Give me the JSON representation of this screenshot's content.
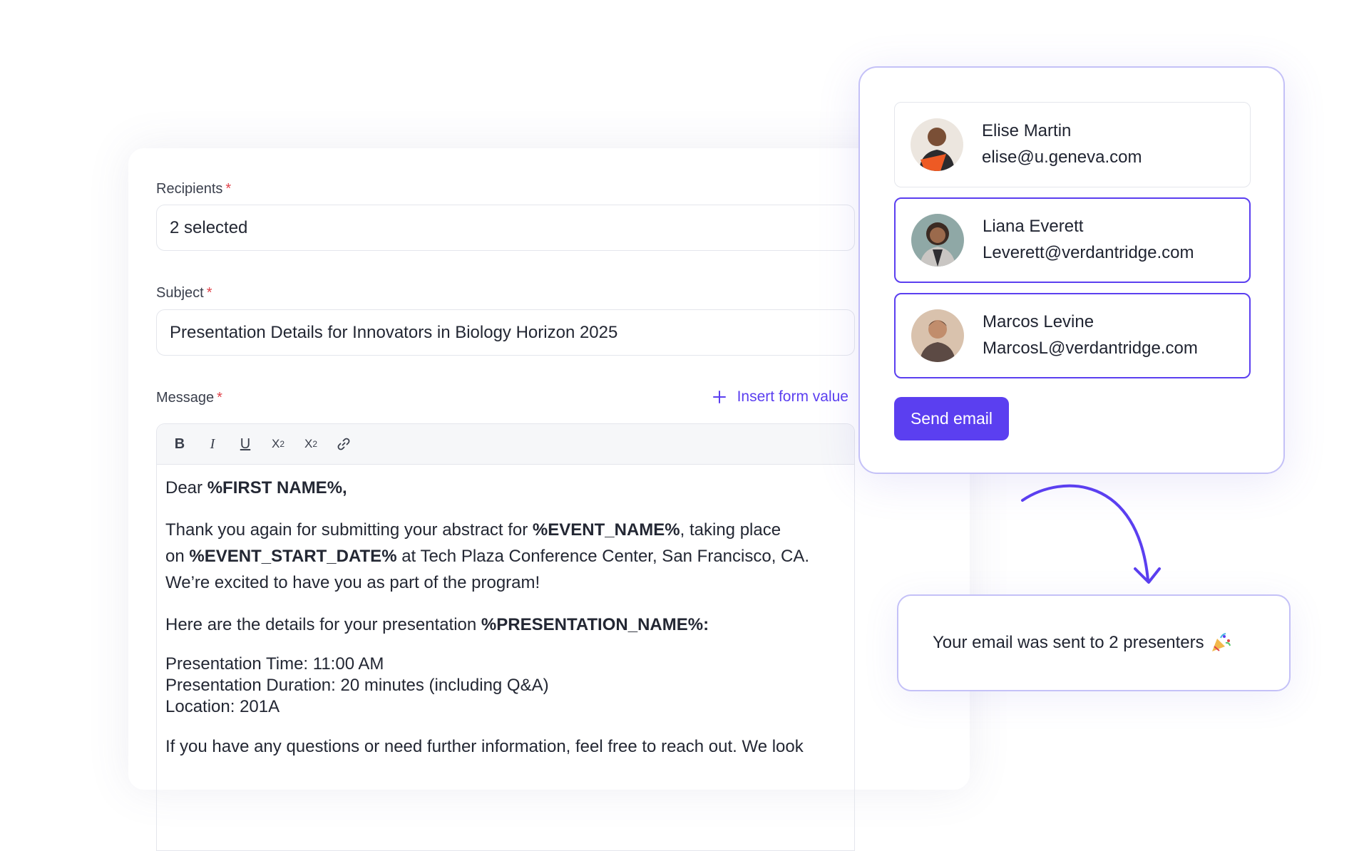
{
  "form": {
    "recipients_label": "Recipients",
    "recipients_value": "2 selected",
    "subject_label": "Subject",
    "subject_value": "Presentation Details for Innovators in Biology Horizon 2025",
    "message_label": "Message",
    "required_mark": "*",
    "insert_form_value": "Insert form value",
    "toolbar": [
      {
        "name": "bold",
        "label": "B"
      },
      {
        "name": "italic",
        "label": "I"
      },
      {
        "name": "underline",
        "label": "U"
      },
      {
        "name": "superscript",
        "label": "X",
        "script": "2"
      },
      {
        "name": "subscript",
        "label": "X",
        "script": "2"
      },
      {
        "name": "link",
        "icon": "link-icon"
      }
    ],
    "message": {
      "greeting_prefix": "Dear ",
      "greeting_token": "%FIRST NAME%,",
      "p1_a": "Thank you again for submitting your abstract for ",
      "p1_token1": "%EVENT_NAME%",
      "p1_b": ", taking place",
      "p1_c": "on ",
      "p1_token2": "%EVENT_START_DATE%",
      "p1_d": " at Tech Plaza Conference Center, San Francisco, CA.",
      "p1_e": "We’re excited to have you as part of the program!",
      "p2_a": "Here are the details for your presentation ",
      "p2_token": "%PRESENTATION_NAME%:",
      "time": "Presentation Time: 11:00 AM",
      "duration": "Presentation Duration: 20 minutes (including Q&A)",
      "location": "Location: 201A",
      "p4": "If you have any questions or need further information, feel free to reach out. We look"
    }
  },
  "recipients": [
    {
      "name": "Elise Martin",
      "email": "elise@u.geneva.com",
      "selected": false
    },
    {
      "name": "Liana Everett",
      "email": "Leverett@verdantridge.com",
      "selected": true
    },
    {
      "name": "Marcos Levine",
      "email": "MarcosL@verdantridge.com",
      "selected": true
    }
  ],
  "send_button": "Send email",
  "confirmation": "Your email was sent to 2 presenters",
  "confirmation_icon": "party-popper-icon",
  "colors": {
    "accent": "#5b3ff0",
    "panel_border": "#c4c1f7",
    "required": "#e0424a"
  }
}
